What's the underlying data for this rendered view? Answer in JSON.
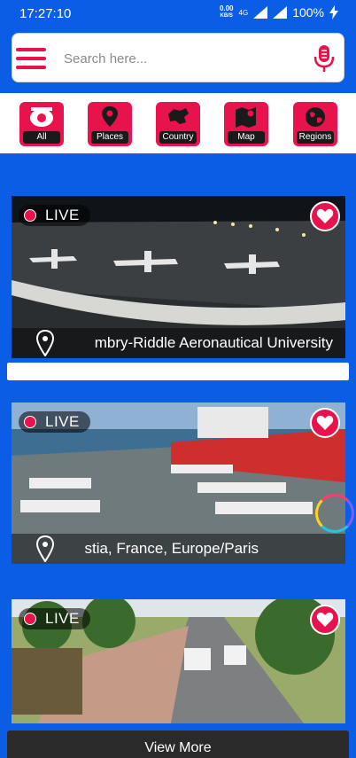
{
  "status_bar": {
    "time": "17:27:10",
    "net_speed": "0.00",
    "net_unit": "KB/S",
    "network_type": "4G",
    "battery": "100%"
  },
  "search": {
    "placeholder": "Search here...",
    "menu_icon": "hamburger-icon",
    "mic_icon": "microphone-icon"
  },
  "categories": [
    {
      "label": "All",
      "icon": "camera-icon"
    },
    {
      "label": "Places",
      "icon": "map-pin-icon"
    },
    {
      "label": "Country",
      "icon": "country-map-icon"
    },
    {
      "label": "Map",
      "icon": "map-icon"
    },
    {
      "label": "Regions",
      "icon": "globe-icon"
    }
  ],
  "cameras": [
    {
      "live_label": "LIVE",
      "location": "mbry-Riddle Aeronautical University",
      "favorite_icon": "heart-icon"
    },
    {
      "live_label": "LIVE",
      "location": "stia, France, Europe/Paris",
      "favorite_icon": "heart-icon"
    },
    {
      "live_label": "LIVE",
      "location": "",
      "favorite_icon": "heart-icon"
    }
  ],
  "view_more_label": "View More",
  "colors": {
    "primary_blue": "#0b5de6",
    "accent_pink": "#e8124c",
    "white": "#ffffff"
  }
}
